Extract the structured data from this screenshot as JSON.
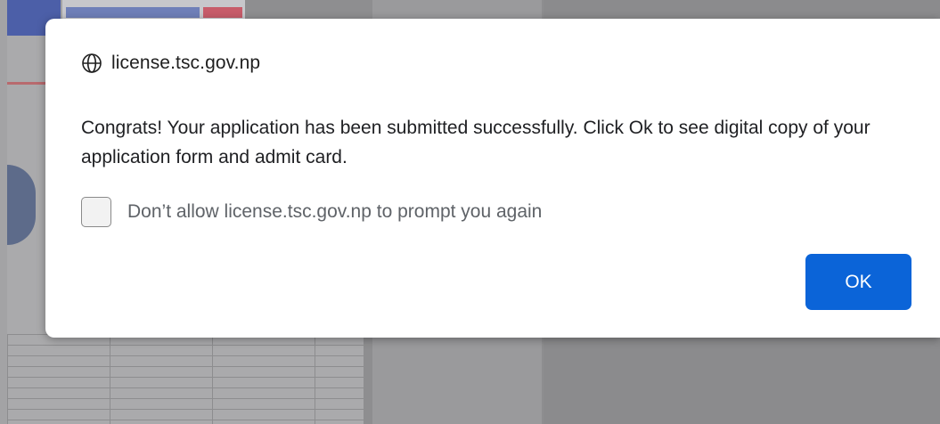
{
  "dialog": {
    "origin": "license.tsc.gov.np",
    "origin_icon": "globe-icon",
    "message": "Congrats! Your application has been submitted successfully. Click Ok to see digital copy of your application form and admit card.",
    "checkbox_label": "Don’t allow license.tsc.gov.np to prompt you again",
    "checkbox_checked": false,
    "ok_label": "OK"
  },
  "colors": {
    "accent": "#0b64d8",
    "dialog_background": "#ffffff",
    "overlay": "#8e8e90"
  }
}
